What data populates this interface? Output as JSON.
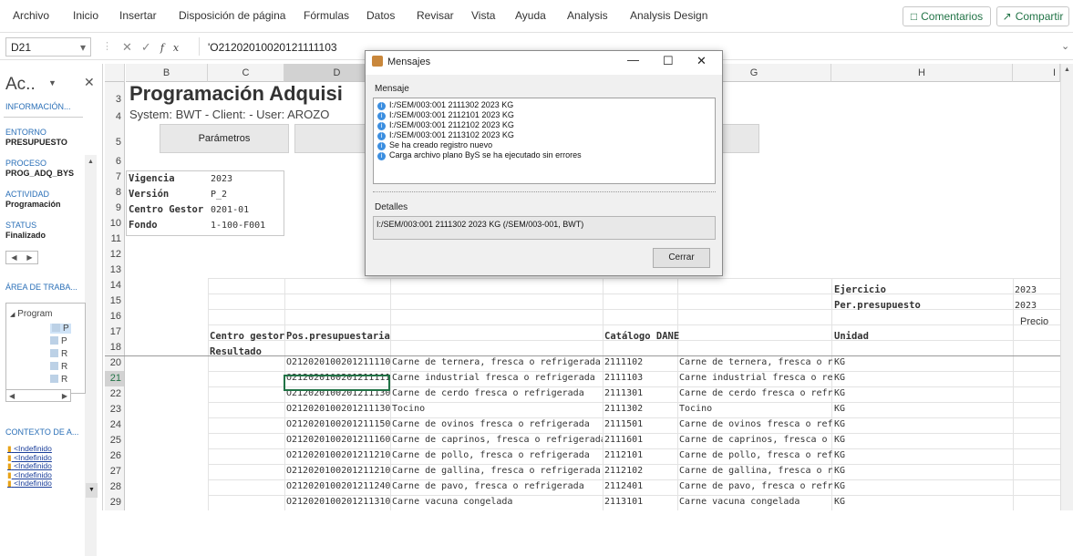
{
  "ribbon": {
    "tabs": [
      "Archivo",
      "Inicio",
      "Insertar",
      "Disposición de página",
      "Fórmulas",
      "Datos",
      "Revisar",
      "Vista",
      "Ayuda",
      "Analysis",
      "Analysis Design"
    ],
    "comments": "Comentarios",
    "share": "Compartir"
  },
  "formula": {
    "cell": "D21",
    "content": "'O21202010020121111103",
    "fx": "fx"
  },
  "pane": {
    "title": "Ac..",
    "info_header": "INFORMACIÓN...",
    "fields": [
      {
        "label": "ENTORNO",
        "value": "PRESUPUESTO"
      },
      {
        "label": "PROCESO",
        "value": "PROG_ADQ_BYS"
      },
      {
        "label": "ACTIVIDAD",
        "value": "Programación"
      },
      {
        "label": "STATUS",
        "value": "Finalizado"
      }
    ],
    "work_area": "ÁREA DE TRABA...",
    "tree_root": "Program",
    "tree_items": [
      "P",
      "P",
      "R",
      "R",
      "R"
    ],
    "context": "CONTEXTO DE A...",
    "context_items": [
      "<Indefinido",
      "<Indefinido",
      "<Indefinido",
      "<Indefinido",
      "<Indefinido"
    ]
  },
  "sheet": {
    "columns": [
      "B",
      "C",
      "D",
      "E",
      "F",
      "G",
      "H",
      "I"
    ],
    "title": "Programación Adquisi",
    "system_line": "System: BWT - Client:  - User: AROZO",
    "params_button": "Parámetros",
    "info_rows": [
      {
        "row": "7",
        "label": "Vigencia",
        "value": "2023"
      },
      {
        "row": "8",
        "label": "Versión",
        "value": "P_2"
      },
      {
        "row": "9",
        "label": "Centro Gestor",
        "value": "0201-01"
      },
      {
        "row": "10",
        "label": "Fondo",
        "value": "1-100-F001"
      }
    ],
    "ejercicio_label": "Ejercicio",
    "ejercicio": "2023",
    "perpres_label": "Per.presupuesto",
    "perpres": "2023",
    "precio": "Precio",
    "hdr_centro": "Centro gestor",
    "hdr_pos": "Pos.presupuestaria",
    "hdr_catalogo": "Catálogo DANE",
    "hdr_unidad": "Unidad",
    "hdr_resultado": "Resultado",
    "rows": [
      {
        "n": "20",
        "pos": "O21202010020121111010",
        "desc": "Carne de ternera, fresca o refrigerada",
        "cat": "2111102",
        "cdesc": "Carne de ternera, fresca o refrigerada",
        "u": "KG"
      },
      {
        "n": "21",
        "pos": "O21202010020121111103",
        "desc": "Carne industrial fresca o refrigerada",
        "cat": "2111103",
        "cdesc": "Carne industrial fresca o refrigerada",
        "u": "KG"
      },
      {
        "n": "22",
        "pos": "O21202010020121113010",
        "desc": "Carne de cerdo fresca o refrigerada",
        "cat": "2111301",
        "cdesc": "Carne de cerdo fresca o refrigerada",
        "u": "KG"
      },
      {
        "n": "23",
        "pos": "O21202010020121113020",
        "desc": "Tocino",
        "cat": "2111302",
        "cdesc": "Tocino",
        "u": "KG"
      },
      {
        "n": "24",
        "pos": "O21202010020121115010",
        "desc": "Carne de ovinos fresca o refrigerada",
        "cat": "2111501",
        "cdesc": "Carne de ovinos fresca o refrigerada",
        "u": "KG"
      },
      {
        "n": "25",
        "pos": "O21202010020121116010",
        "desc": "Carne de caprinos, fresca o refrigerada",
        "cat": "2111601",
        "cdesc": "Carne de caprinos, fresca o refrigerada",
        "u": "KG"
      },
      {
        "n": "26",
        "pos": "O21202010020121121010",
        "desc": "Carne de pollo, fresca o refrigerada",
        "cat": "2112101",
        "cdesc": "Carne de pollo, fresca o refrigerada",
        "u": "KG"
      },
      {
        "n": "27",
        "pos": "O21202010020121121020",
        "desc": "Carne de gallina, fresca o refrigerada",
        "cat": "2112102",
        "cdesc": "Carne de gallina, fresca o refrigerada",
        "u": "KG"
      },
      {
        "n": "28",
        "pos": "O21202010020121124010",
        "desc": "Carne de pavo, fresca o refrigerada",
        "cat": "2112401",
        "cdesc": "Carne de pavo, fresca o refrigerada",
        "u": "KG"
      },
      {
        "n": "29",
        "pos": "O21202010020121131010",
        "desc": "Carne vacuna congelada",
        "cat": "2113101",
        "cdesc": "Carne vacuna congelada",
        "u": "KG"
      }
    ]
  },
  "dialog": {
    "title": "Mensajes",
    "msg_label": "Mensaje",
    "messages": [
      "I:/SEM/003:001 2111302 2023 KG",
      "I:/SEM/003:001 2112101 2023 KG",
      "I:/SEM/003:001 2112102 2023 KG",
      "I:/SEM/003:001 2113102 2023 KG",
      "Se ha creado registro nuevo",
      "Carga archivo plano ByS se ha ejecutado sin errores"
    ],
    "det_label": "Detalles",
    "details": "I:/SEM/003:001 2111302 2023 KG (/SEM/003-001, BWT)",
    "close": "Cerrar"
  }
}
